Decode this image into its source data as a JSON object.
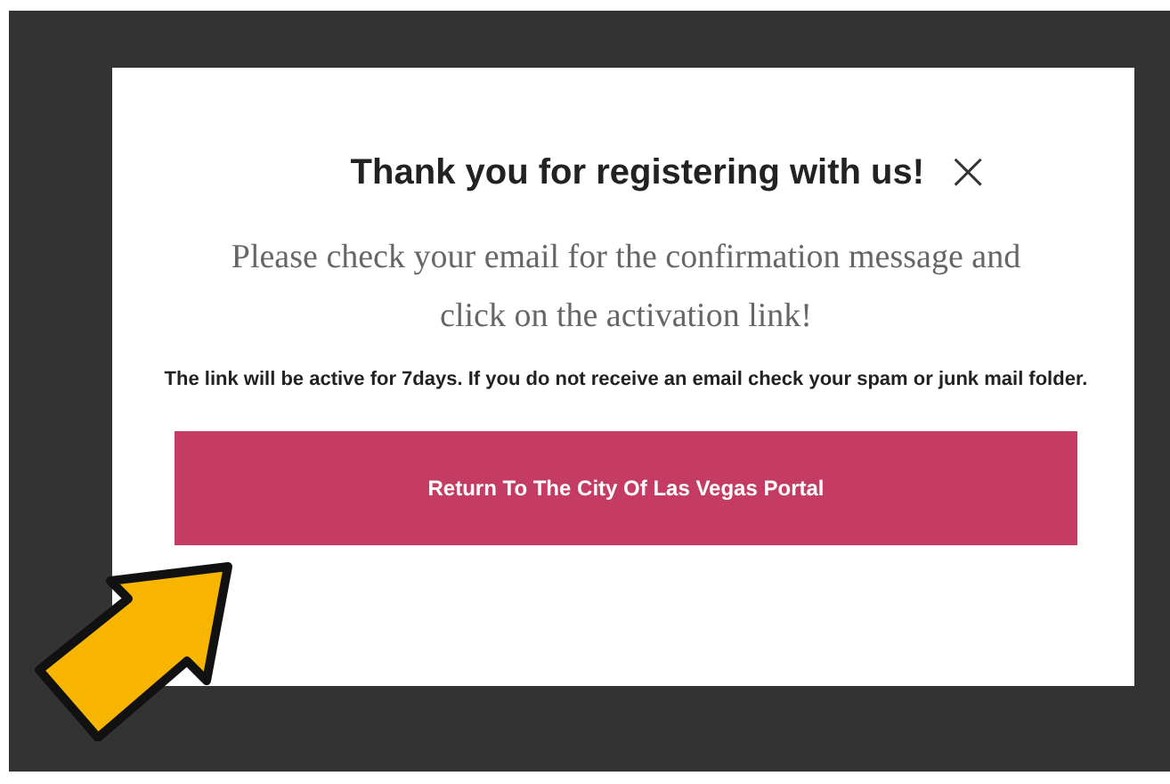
{
  "modal": {
    "title": "Thank you for registering with us!",
    "close": "×",
    "message": "Please check your email for the confirmation message and click on the activation link!",
    "note": "The link will be active for 7days. If you do not receive an email check your spam or junk mail folder.",
    "button": "Return To The City Of Las Vegas Portal"
  }
}
